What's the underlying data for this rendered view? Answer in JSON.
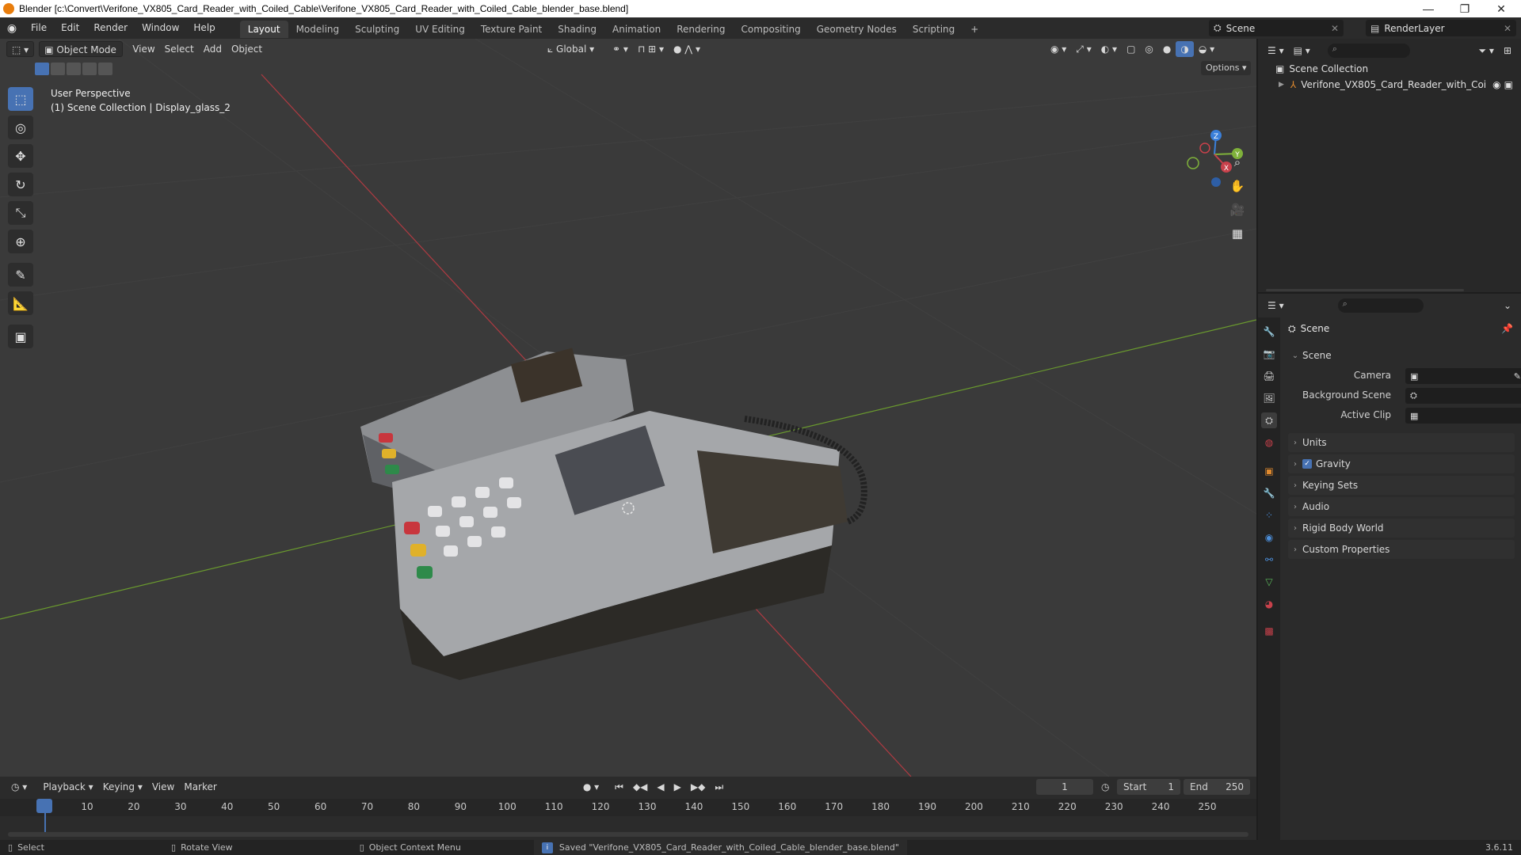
{
  "window": {
    "title": "Blender [c:\\Convert\\Verifone_VX805_Card_Reader_with_Coiled_Cable\\Verifone_VX805_Card_Reader_with_Coiled_Cable_blender_base.blend]",
    "controls": [
      "—",
      "❐",
      "✕"
    ]
  },
  "menu": [
    "File",
    "Edit",
    "Render",
    "Window",
    "Help"
  ],
  "workspaces": [
    "Layout",
    "Modeling",
    "Sculpting",
    "UV Editing",
    "Texture Paint",
    "Shading",
    "Animation",
    "Rendering",
    "Compositing",
    "Geometry Nodes",
    "Scripting",
    "+"
  ],
  "active_workspace": "Layout",
  "scene_selector": {
    "label": "Scene"
  },
  "renderlayer_selector": {
    "label": "RenderLayer"
  },
  "viewport": {
    "mode": "Object Mode",
    "menus": [
      "View",
      "Select",
      "Add",
      "Object"
    ],
    "orientation": "Global",
    "options_label": "Options",
    "overlay_line1": "User Perspective",
    "overlay_line2": "(1) Scene Collection | Display_glass_2",
    "gizmo": {
      "z": "Z",
      "y": "Y",
      "x": "X"
    },
    "tools": [
      "select-box",
      "cursor",
      "move",
      "rotate",
      "scale",
      "transform",
      "annotate",
      "measure",
      "add-cube"
    ]
  },
  "outliner": {
    "root": "Scene Collection",
    "items": [
      {
        "label": "Verifone_VX805_Card_Reader_with_Coi"
      }
    ]
  },
  "properties": {
    "context_title": "Scene",
    "panel_scene": "Scene",
    "camera_label": "Camera",
    "background_scene_label": "Background Scene",
    "active_clip_label": "Active Clip",
    "panels": [
      "Units",
      "Gravity",
      "Keying Sets",
      "Audio",
      "Rigid Body World",
      "Custom Properties"
    ],
    "gravity_checked": true
  },
  "timeline": {
    "menus": [
      "Playback",
      "Keying",
      "View",
      "Marker"
    ],
    "current_frame": "1",
    "start_label": "Start",
    "start_value": "1",
    "end_label": "End",
    "end_value": "250",
    "ticks": [
      "1",
      "10",
      "20",
      "30",
      "40",
      "50",
      "60",
      "70",
      "80",
      "90",
      "100",
      "110",
      "120",
      "130",
      "140",
      "150",
      "160",
      "170",
      "180",
      "190",
      "200",
      "210",
      "220",
      "230",
      "240",
      "250"
    ]
  },
  "statusbar": {
    "select": "Select",
    "rotate": "Rotate View",
    "context_menu": "Object Context Menu",
    "message": "Saved \"Verifone_VX805_Card_Reader_with_Coiled_Cable_blender_base.blend\"",
    "version": "3.6.11"
  },
  "colors": {
    "accent": "#4772b3",
    "x_axis": "#c8414b",
    "y_axis": "#7fb13a",
    "z_axis": "#3a7fd9"
  }
}
